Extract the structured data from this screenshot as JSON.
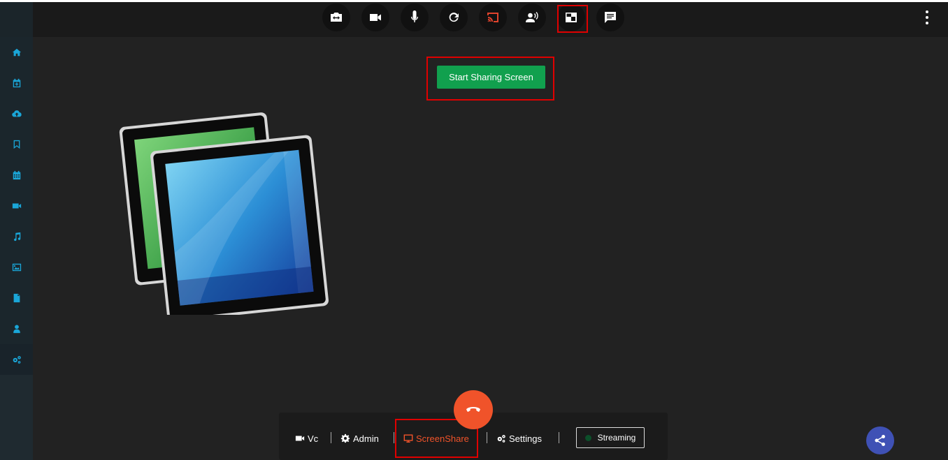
{
  "colors": {
    "accent_red": "#e00000",
    "green": "#11a04e",
    "end_call": "#f0532a",
    "sidebar_icon": "#1aa6d8",
    "fab": "#3f51b5"
  },
  "sidebar": {
    "items": [
      {
        "icon": "home-icon"
      },
      {
        "icon": "calendar-plus-icon"
      },
      {
        "icon": "cloud-upload-icon"
      },
      {
        "icon": "bookmark-icon"
      },
      {
        "icon": "calendar-icon"
      },
      {
        "icon": "video-camera-icon"
      },
      {
        "icon": "music-note-icon"
      },
      {
        "icon": "image-icon"
      },
      {
        "icon": "document-icon"
      },
      {
        "icon": "user-icon"
      },
      {
        "icon": "settings-gears-icon"
      }
    ]
  },
  "topbar": {
    "buttons": [
      {
        "icon": "switch-camera-icon"
      },
      {
        "icon": "video-camera-icon"
      },
      {
        "icon": "microphone-icon"
      },
      {
        "icon": "refresh-icon"
      },
      {
        "icon": "cast-icon"
      },
      {
        "icon": "speaking-user-icon"
      },
      {
        "icon": "picture-in-picture-icon"
      },
      {
        "icon": "chat-icon"
      }
    ],
    "more_icon": "more-vertical-icon"
  },
  "main": {
    "start_button_label": "Start Sharing Screen",
    "illustration": "screen-share-illustration"
  },
  "bottombar": {
    "tabs": [
      {
        "label": "Vc",
        "icon": "video-camera-icon"
      },
      {
        "label": "Admin",
        "icon": "gear-icon"
      },
      {
        "label": "ScreenShare",
        "icon": "monitor-icon",
        "active": true
      },
      {
        "label": "Settings",
        "icon": "gears-icon"
      }
    ],
    "streaming_label": "Streaming"
  },
  "end_call_icon": "end-call-icon",
  "share_icon": "share-icon"
}
